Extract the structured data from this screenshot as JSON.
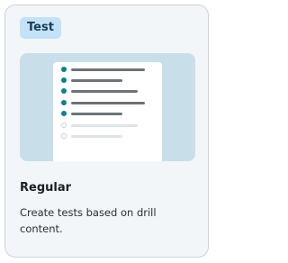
{
  "card": {
    "badge": "Test",
    "title": "Regular",
    "description": "Create tests based on drill content."
  },
  "illustration": {
    "icon": "checklist-document-illustration",
    "rows": [
      {
        "checked": true
      },
      {
        "checked": true
      },
      {
        "checked": true
      },
      {
        "checked": true
      },
      {
        "checked": true
      },
      {
        "checked": false
      },
      {
        "checked": false
      }
    ]
  },
  "colors": {
    "badge_bg": "#c3e2f7",
    "accent": "#1ea0d8",
    "check": "#0e7f8f",
    "card_bg": "#f3f6f9"
  }
}
